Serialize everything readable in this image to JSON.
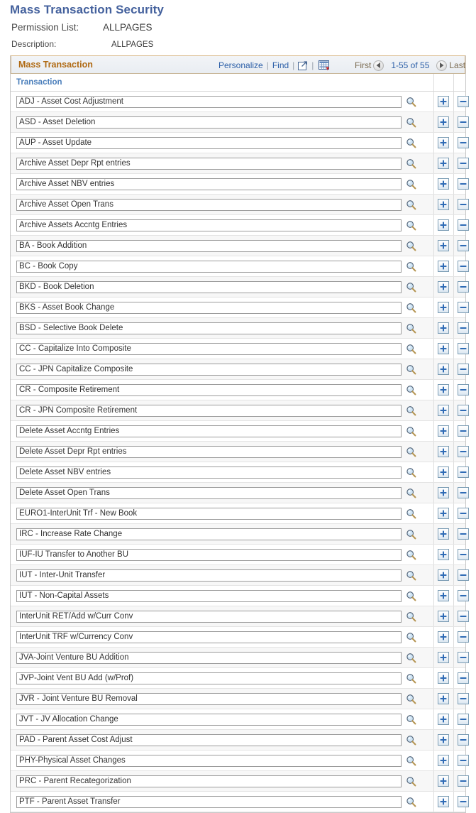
{
  "page": {
    "title": "Mass Transaction Security"
  },
  "fields": {
    "permission_list_label": "Permission List:",
    "permission_list_value": "ALLPAGES",
    "description_label": "Description:",
    "description_value": "ALLPAGES"
  },
  "grid": {
    "title": "Mass Transaction",
    "personalize_label": "Personalize",
    "find_label": "Find",
    "sep1": "|",
    "sep2": "|",
    "sep3": "|",
    "zoom_icon_name": "expand-grid-icon",
    "download_icon_name": "download-to-excel-icon",
    "first_label": "First",
    "last_label": "Last",
    "range_label": "1-55 of 55",
    "prev_arrow_icon": "previous-page-arrow-icon",
    "next_arrow_icon": "next-page-arrow-icon",
    "column_header": "Transaction",
    "add_button_label": "+",
    "delete_button_label": "-",
    "lookup_icon_name": "lookup-magnifier-icon",
    "rows": [
      {
        "transaction": "ADJ - Asset Cost Adjustment"
      },
      {
        "transaction": "ASD - Asset Deletion"
      },
      {
        "transaction": "AUP - Asset Update"
      },
      {
        "transaction": "Archive Asset Depr Rpt entries"
      },
      {
        "transaction": "Archive Asset NBV entries"
      },
      {
        "transaction": "Archive Asset Open Trans"
      },
      {
        "transaction": "Archive Assets Accntg Entries"
      },
      {
        "transaction": "BA - Book Addition"
      },
      {
        "transaction": "BC - Book Copy"
      },
      {
        "transaction": "BKD - Book Deletion"
      },
      {
        "transaction": "BKS - Asset Book Change"
      },
      {
        "transaction": "BSD - Selective Book Delete"
      },
      {
        "transaction": "CC - Capitalize Into Composite"
      },
      {
        "transaction": "CC - JPN Capitalize Composite"
      },
      {
        "transaction": "CR - Composite Retirement"
      },
      {
        "transaction": "CR - JPN Composite Retirement"
      },
      {
        "transaction": "Delete Asset Accntg Entries"
      },
      {
        "transaction": "Delete Asset Depr Rpt entries"
      },
      {
        "transaction": "Delete Asset NBV entries"
      },
      {
        "transaction": "Delete Asset Open Trans"
      },
      {
        "transaction": "EURO1-InterUnit Trf - New Book"
      },
      {
        "transaction": "IRC - Increase Rate Change"
      },
      {
        "transaction": "IUF-IU Transfer to Another BU"
      },
      {
        "transaction": "IUT - Inter-Unit Transfer"
      },
      {
        "transaction": "IUT - Non-Capital Assets"
      },
      {
        "transaction": "InterUnit RET/Add w/Curr Conv"
      },
      {
        "transaction": "InterUnit TRF w/Currency Conv"
      },
      {
        "transaction": "JVA-Joint Venture BU Addition"
      },
      {
        "transaction": "JVP-Joint Vent BU Add (w/Prof)"
      },
      {
        "transaction": "JVR - Joint Venture BU Removal"
      },
      {
        "transaction": "JVT - JV Allocation Change"
      },
      {
        "transaction": "PAD - Parent Asset Cost Adjust"
      },
      {
        "transaction": "PHY-Physical Asset Changes"
      },
      {
        "transaction": "PRC - Parent Recategorization"
      },
      {
        "transaction": "PTF - Parent Asset Transfer"
      }
    ]
  },
  "colors": {
    "title_blue": "#44619d",
    "grid_title_orange": "#b06a14",
    "link_blue": "#2c5fa8",
    "column_header_blue": "#4a7ebb"
  }
}
